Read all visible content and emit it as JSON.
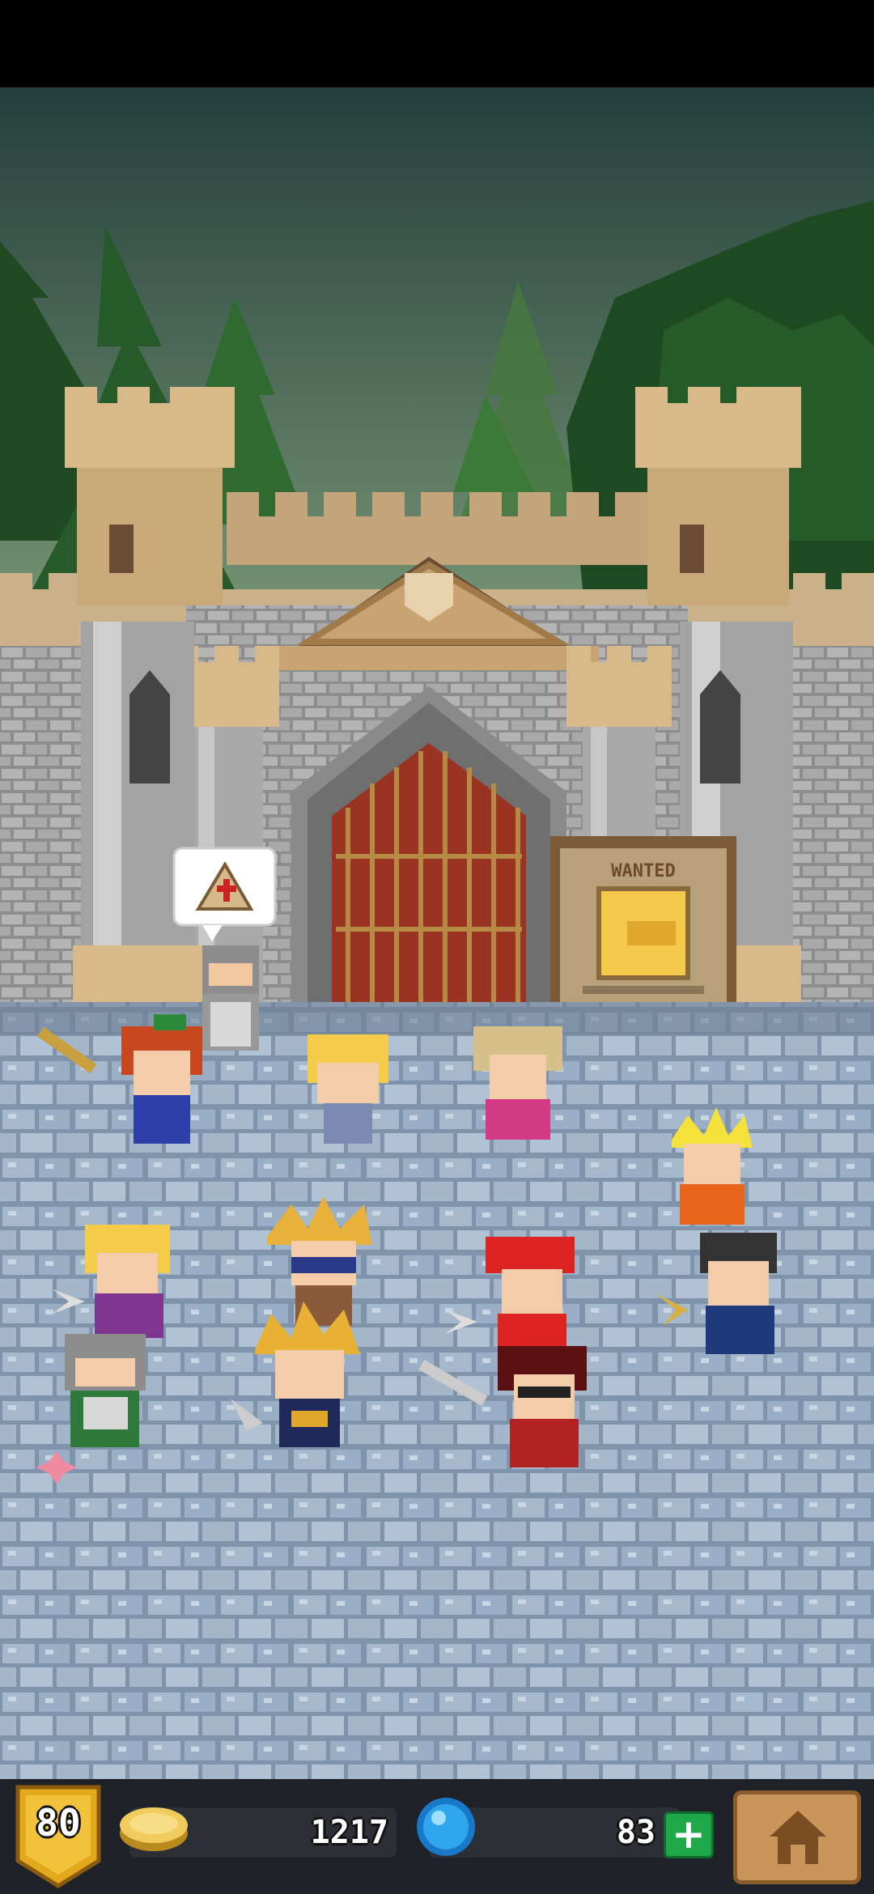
{
  "hud": {
    "level": "80",
    "gold": "1217",
    "gems": "83",
    "add_label": "+",
    "icons": {
      "gold": "gold-coin-icon",
      "gem": "blue-gem-icon",
      "home": "home-icon",
      "add": "plus-icon"
    }
  },
  "scene": {
    "notice_board": "WANTED",
    "speech_bubble_icon": "church-icon",
    "colors": {
      "sky": "#2c5848",
      "castle_stone": "#9c9c9c",
      "castle_tower": "#d8b98a",
      "door": "#9a3322",
      "floor": "#8ea2b8"
    }
  }
}
